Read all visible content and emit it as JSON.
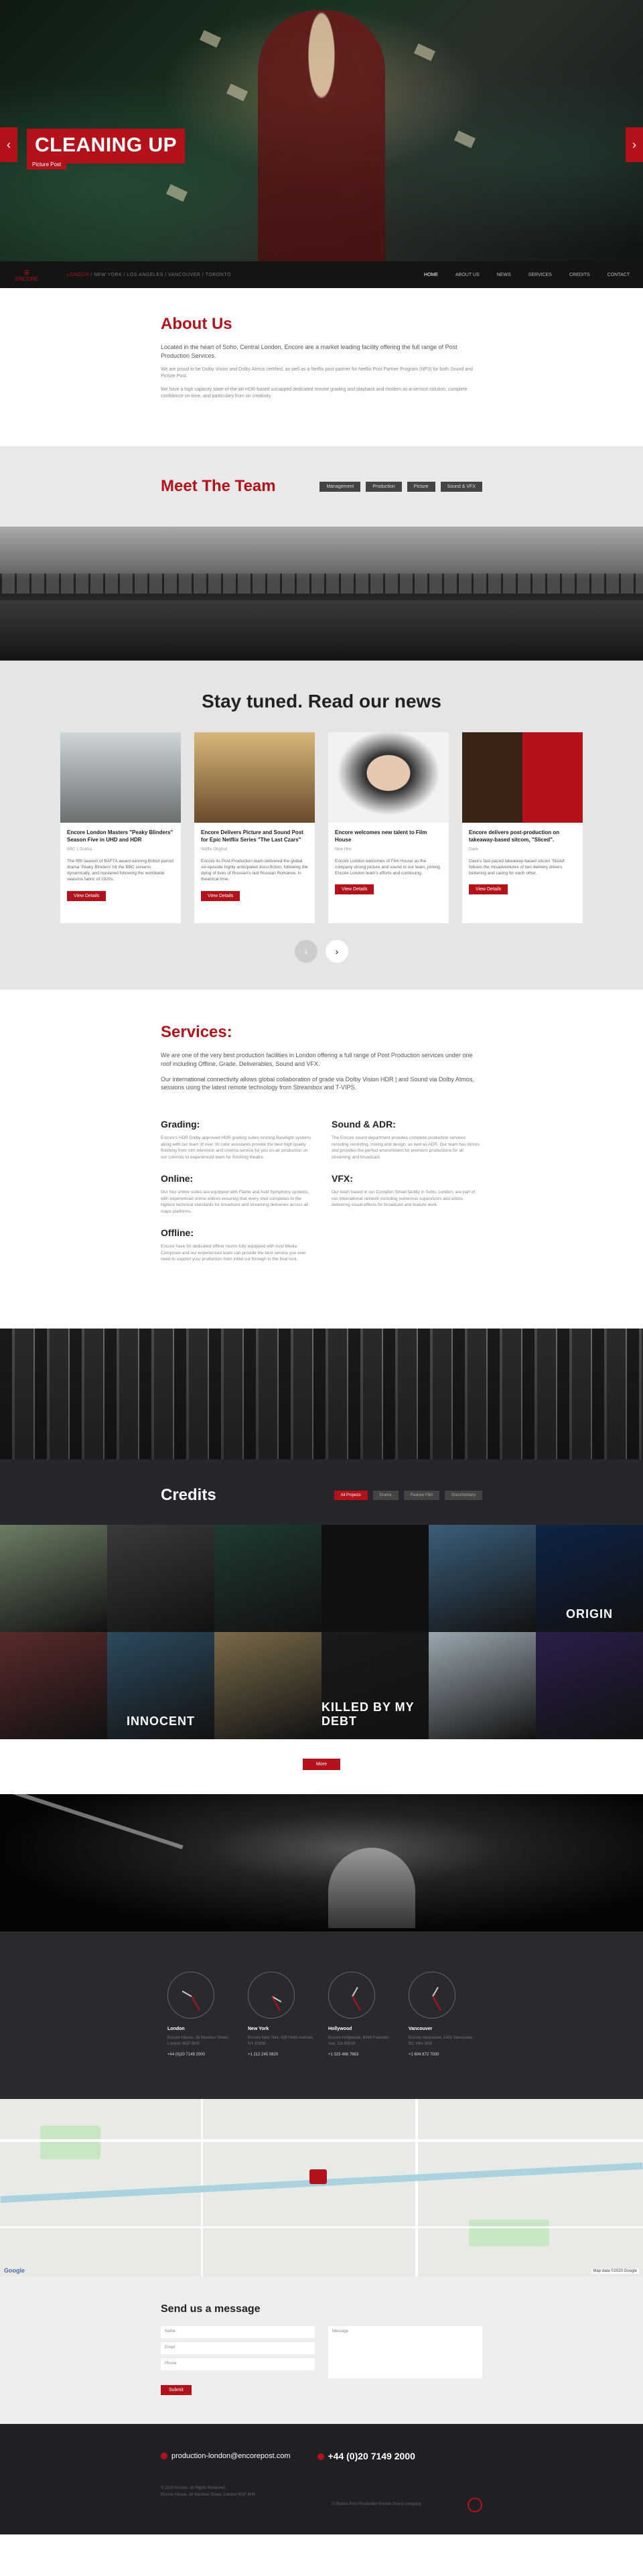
{
  "hero": {
    "title": "CLEANING UP",
    "subtitle": "Picture Post",
    "prev_label": "‹",
    "next_label": "›"
  },
  "nav": {
    "logo_text": "ENCORE",
    "cities": [
      "LONDON",
      "NEW YORK",
      "LOS ANGELES",
      "VANCOUVER",
      "TORONTO"
    ],
    "items": [
      "HOME",
      "ABOUT US",
      "NEWS",
      "SERVICES",
      "CREDITS",
      "CONTACT"
    ],
    "active_item": "HOME"
  },
  "about": {
    "title": "About Us",
    "p1": "Located in the heart of Soho, Central London, Encore are a market leading facility offering the full range of Post Production Services.",
    "p2": "We are proud to be Dolby Vision and Dolby Atmos certified, as well as a Netflix post partner for Netflix Post Partner Program (NP3) for both Sound and Picture Post.",
    "p3": "We have a high capacity state-of-the-art HDR-based uncapped dedicated remote grading and playback and modern as-a-service solution, complete confidence on-time, and particulary from on creativity."
  },
  "team": {
    "title": "Meet The Team",
    "buttons": [
      "Management",
      "Production",
      "Picture",
      "Sound & VFX"
    ]
  },
  "news": {
    "title": "Stay tuned. Read our news",
    "read_label": "View Details",
    "cards": [
      {
        "title": "Encore London Masters \"Peaky Blinders\" Season Five in UHD and HDR",
        "meta": "BBC 1 Drama",
        "text": "The fifth season of BAFTA award-winning British period drama 'Peaky Blinders' hit the BBC screens dynamically, and mastered following the worldwide seasons fabric of 1920s."
      },
      {
        "title": "Encore Delivers Picture and Sound Post for Epic Netflix Series \"The Last Czars\"",
        "meta": "Netflix Original",
        "text": "Encore its Post-Production team delivered the global six-episode highly anticipated docu-fiction, following the dying of lives of Russian's last Russian Romanov, in theatrical time."
      },
      {
        "title": "Encore welcomes new talent to Film House",
        "meta": "New Hire",
        "text": "Encore London welcomes of Film House as the company strong picture and sound to our team, joining Encore London team's efforts and continuing."
      },
      {
        "title": "Encore delivers post-production on takeaway-based sitcom, \"Sliced\".",
        "meta": "Dave",
        "text": "Dave's fast-paced takeaway-based sitcom 'Sliced' follows the misadventures of two delivery drivers bickering and caring for each other."
      }
    ]
  },
  "services": {
    "title": "Services:",
    "intro1": "We are one of the very best production facilities in London offering a full range of Post Production services under one roof including Offline, Grade, Deliverables, Sound and VFX.",
    "intro2": "Our international connectivity allows global collaboration of grade via Dolby Vision HDR | and Sound via Dolby Atmos, sessions using the latest remote technology from Streambox and T-VIPS.",
    "items": [
      {
        "name": "Grading:",
        "text": "Encore's HDR Dolby-approved HDR grading suites running Baselight systems along with our team of over 30 color assistants provide the best high quality finishing from rom television and cinema service for you on-air production on our colorists to experienced team for finishing theatre."
      },
      {
        "name": "Sound & ADR:",
        "text": "The Encore sound department provides complete production services including recording, mixing and design, as well as ADR. Our team has Atmos and provides the perfect environment for premium productions for all streaming and broadcast."
      },
      {
        "name": "Online:",
        "text": "Our four online suites are equipped with Flame and Avid Symphony systems, with experienced online editors ensuring that every shot completes to the highest technical standards for broadcast and streaming deliveries across all major platforms."
      },
      {
        "name": "VFX:",
        "text": "Our team based in our Compton Street facility in Soho, London, are part of our international network including numerous supervisors and artists delivering visual effects for broadcast and feature work."
      },
      {
        "name": "Offline:",
        "text": "Encore have 50 dedicated offline rooms fully equipped with Avid Media Composer and our experienced team can provide the best service you ever need to support your production from initial cut through to the final lock."
      }
    ]
  },
  "credits": {
    "title": "Credits",
    "filters": [
      "All Projects",
      "Drama",
      "Feature Film",
      "Documentary"
    ],
    "active_filter": "All Projects",
    "posters": [
      {
        "label": "",
        "color": "#6b7d63"
      },
      {
        "label": "",
        "color": "#3a3a3a"
      },
      {
        "label": "",
        "color": "#203a34"
      },
      {
        "label": "",
        "color": "#111111"
      },
      {
        "label": "",
        "color": "#3b5e7a"
      },
      {
        "label": "ORIGIN",
        "color": "#0e2346"
      },
      {
        "label": "",
        "color": "#5a2a2a"
      },
      {
        "label": "INNOCENT",
        "color": "#2c4a5e"
      },
      {
        "label": "",
        "color": "#7a6a4a"
      },
      {
        "label": "KILLED BY MY DEBT",
        "color": "#1a1a1a"
      },
      {
        "label": "",
        "color": "#9aa7b0"
      },
      {
        "label": "",
        "color": "#2b1e4a"
      }
    ],
    "more_label": "More"
  },
  "offices": [
    {
      "city": "London",
      "address": "Encore House, 16 Wardour Street, London W1F 8HS",
      "tel": "+44 (0)20 7149 2000",
      "hour_deg": 300,
      "min_deg": 150
    },
    {
      "city": "New York",
      "address": "Encore New York, 630 Ninth Avenue, NY 10036",
      "tel": "+1 212 245 0620",
      "hour_deg": 120,
      "min_deg": 150
    },
    {
      "city": "Hollywood",
      "address": "Encore Hollywood, 6344 Fountain Ave, CA 90028",
      "tel": "+1 323 466 7663",
      "hour_deg": 30,
      "min_deg": 150
    },
    {
      "city": "Vancouver",
      "address": "Encore Vancouver, 1401 Vancouver, BC V6H 3G9",
      "tel": "+1 604 872 7000",
      "hour_deg": 30,
      "min_deg": 150
    }
  ],
  "map": {
    "google_label": "Google",
    "attribution": "Map data ©2020 Google"
  },
  "contact": {
    "title": "Send us a message",
    "name_placeholder": "Name",
    "email_placeholder": "Email",
    "phone_placeholder": "Phone",
    "message_placeholder": "Message",
    "submit_label": "Submit"
  },
  "footer": {
    "email": "production-london@encorepost.com",
    "phone": "+44 (0)20 7149 2000",
    "copyright": "© 2020 Encore. All Rights Reserved.",
    "address": "Encore House, 16 Wardour Street, London W1F 8HS",
    "copyright_right": "© Picture Post Production Encore Group company"
  }
}
